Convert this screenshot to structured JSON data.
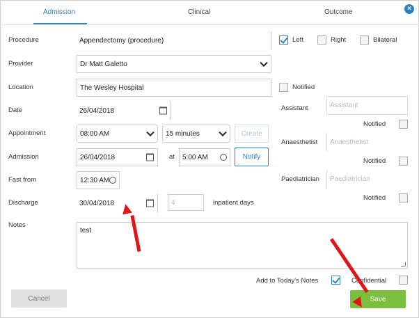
{
  "tabs": [
    {
      "label": "Admission",
      "active": true
    },
    {
      "label": "Clinical",
      "active": false
    },
    {
      "label": "Outcome",
      "active": false
    }
  ],
  "close_glyph": "×",
  "labels": {
    "procedure": "Procedure",
    "provider": "Provider",
    "location": "Location",
    "date": "Date",
    "appointment": "Appointment",
    "admission": "Admission",
    "fast_from": "Fast from",
    "discharge": "Discharge",
    "notes": "Notes",
    "at": "at",
    "inpatient_days": "inpatient days",
    "assistant": "Assistant",
    "anaesthetist": "Anaesthetist",
    "paediatrician": "Paediatrician",
    "notified": "Notified",
    "add_to_notes": "Add to Today's Notes",
    "confidential": "Confidential"
  },
  "fields": {
    "procedure": "Appendectomy (procedure)",
    "provider": "Dr Matt Galetto",
    "location": "The Wesley Hospital",
    "date": "26/04/2018",
    "appointment_time": "08:00 AM",
    "appointment_duration": "15 minutes",
    "admission_date": "26/04/2018",
    "admission_time": "5:00 AM",
    "fast_from": "12:30 AM",
    "discharge_date": "30/04/2018",
    "inpatient_days": "4",
    "notes": "test",
    "assistant_placeholder": "Assistant",
    "anaesthetist_placeholder": "Anaesthetist",
    "paediatrician_placeholder": "Paediatrician"
  },
  "side": {
    "left": {
      "label": "Left",
      "checked": true
    },
    "right": {
      "label": "Right",
      "checked": false
    },
    "bilateral": {
      "label": "Bilateral",
      "checked": false
    }
  },
  "checkboxes": {
    "location_notified": false,
    "assistant_notified": false,
    "anaesthetist_notified": false,
    "paediatrician_notified": false,
    "add_to_notes": true,
    "confidential": false
  },
  "buttons": {
    "create": "Create",
    "notify": "Notify",
    "cancel": "Cancel",
    "save": "Save"
  },
  "colors": {
    "accent": "#2f80c2",
    "save": "#7cbe3e",
    "annotation_arrow": "#e01616"
  }
}
